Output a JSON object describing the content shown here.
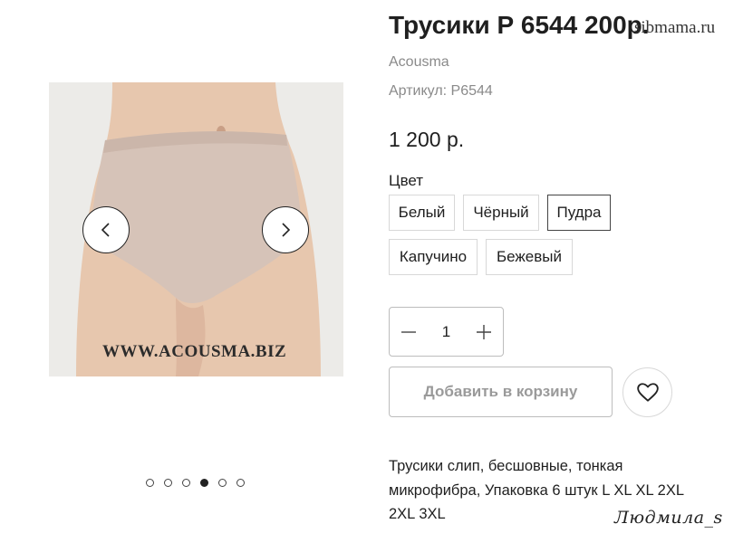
{
  "product": {
    "title": "Трусики Р 6544 200р.",
    "brand": "Acousma",
    "sku_label": "Артикул: Р6544",
    "price": "1 200 р."
  },
  "site_watermark": "sibmama.ru",
  "gallery": {
    "image_watermark": "WWW.ACOUSMA.BIZ",
    "prev_icon": "chevron-left-icon",
    "next_icon": "chevron-right-icon",
    "dot_count": 6,
    "active_dot": 4
  },
  "color": {
    "label": "Цвет",
    "options": [
      "Белый",
      "Чёрный",
      "Пудра",
      "Капучино",
      "Бежевый"
    ],
    "selected": "Пудра"
  },
  "quantity": {
    "value": "1",
    "minus_icon": "minus-icon",
    "plus_icon": "plus-icon"
  },
  "actions": {
    "add_to_cart": "Добавить в корзину",
    "wishlist_icon": "heart-icon"
  },
  "description": "Трусики слип, бесшовные, тонкая микрофибра, Упаковка 6 штук L XL XL 2XL 2XL 3XL",
  "signature": "Людмила_s",
  "colors": {
    "text": "#1f1f1f",
    "muted": "#8a8a8a",
    "button_disabled_text": "#9a9a9a",
    "border": "#d8d8d8",
    "photo_background": "#ecebe8",
    "garment": "#d6c3b8"
  }
}
